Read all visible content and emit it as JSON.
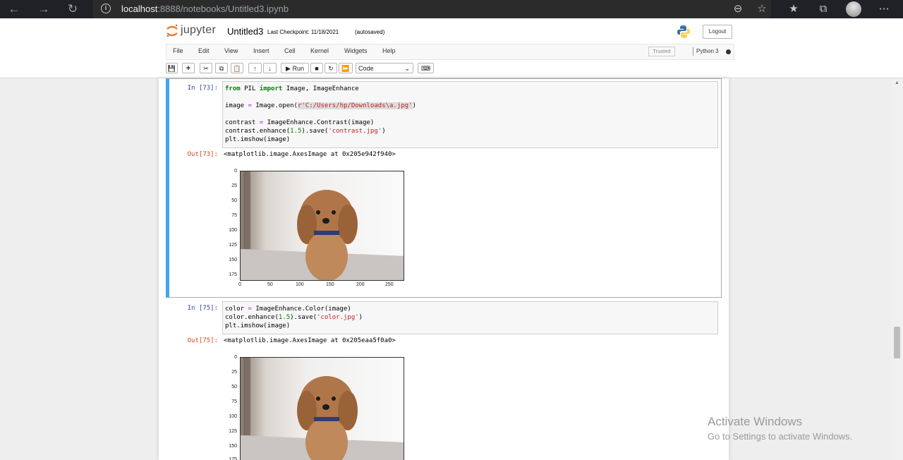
{
  "browser": {
    "url_host": "localhost",
    "url_path": ":8888/notebooks/Untitled3.ipynb"
  },
  "header": {
    "logo_text": "jupyter",
    "notebook_name": "Untitled3",
    "checkpoint": "Last Checkpoint: 11/18/2021",
    "autosave": "(autosaved)",
    "logout_label": "Logout"
  },
  "menubar": {
    "items": [
      "File",
      "Edit",
      "View",
      "Insert",
      "Cell",
      "Kernel",
      "Widgets",
      "Help"
    ],
    "trusted": "Trusted",
    "kernel": "Python 3"
  },
  "toolbar": {
    "run_label": "Run",
    "cell_type": "Code",
    "cell_type_options": [
      "Code"
    ]
  },
  "cells": [
    {
      "in_prompt": "In [73]:",
      "code_lines": [
        "from PIL import Image, ImageEnhance",
        "",
        "image = Image.open(r'C:/Users/hp/Downloads\\a.jpg')",
        "",
        "contrast = ImageEnhance.Contrast(image)",
        "contrast.enhance(1.5).save('contrast.jpg')",
        "plt.imshow(image)"
      ],
      "out_prompt": "Out[73]:",
      "out_text": "<matplotlib.image.AxesImage at 0x205e942f940>",
      "yticks": [
        "0",
        "25",
        "50",
        "75",
        "100",
        "125",
        "150",
        "175"
      ],
      "xticks": [
        "0",
        "50",
        "100",
        "150",
        "200",
        "250"
      ]
    },
    {
      "in_prompt": "In [75]:",
      "code_lines": [
        "color = ImageEnhance.Color(image)",
        "color.enhance(1.5).save('color.jpg')",
        "plt.imshow(image)"
      ],
      "out_prompt": "Out[75]:",
      "out_text": "<matplotlib.image.AxesImage at 0x205eaa5f0a0>",
      "yticks": [
        "0",
        "25",
        "50",
        "75",
        "100",
        "125",
        "150",
        "175"
      ]
    }
  ],
  "watermark": {
    "title": "Activate Windows",
    "subtitle": "Go to Settings to activate Windows."
  }
}
